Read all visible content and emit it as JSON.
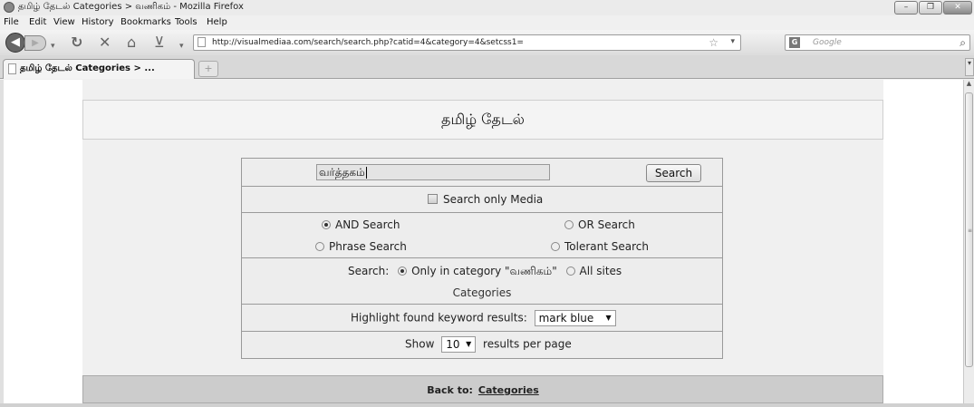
{
  "window": {
    "title": "தமிழ் தேடல் Categories > வணிகம் - Mozilla Firefox",
    "controls": [
      "–",
      "❐",
      "✕"
    ]
  },
  "menu": [
    "File",
    "Edit",
    "View",
    "History",
    "Bookmarks",
    "Tools",
    "Help"
  ],
  "nav": {
    "url": "http://visualmediaa.com/search/search.php?catid=4&category=4&setcss1=",
    "search_placeholder": "Google",
    "search_engine_icon": "G"
  },
  "tab": {
    "label": "தமிழ் தேடல் Categories > ...",
    "new_tab": "+"
  },
  "page": {
    "site_title": "தமிழ் தேடல்",
    "query_value": "வர்த்தகம்",
    "search_button": "Search",
    "media_only_label": "Search only Media",
    "and_search": "AND Search",
    "or_search": "OR Search",
    "phrase_search": "Phrase Search",
    "tolerant_search": "Tolerant Search",
    "scope_label": "Search:",
    "scope_category": "Only in category \"வணிகம்\"",
    "scope_all": "All sites",
    "categories_label": "Categories",
    "highlight_label": "Highlight found keyword results:",
    "highlight_value": "mark blue",
    "show_label": "Show",
    "per_page_value": "10",
    "per_page_suffix": "results per page",
    "back_label": "Back to:",
    "back_link": "Categories"
  }
}
